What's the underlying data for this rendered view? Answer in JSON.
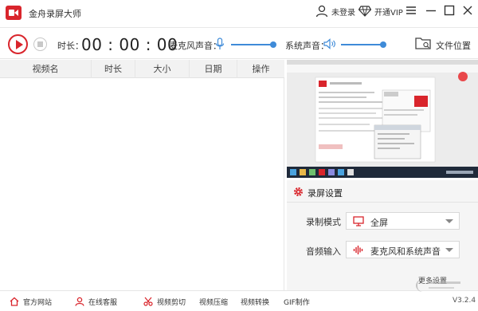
{
  "app": {
    "title": "金舟录屏大师"
  },
  "header": {
    "login_label": "未登录",
    "vip_label": "开通VIP"
  },
  "toolbar": {
    "duration_label": "时长：",
    "timer": "00 : 00 : 00",
    "mic_label": "麦克风声音：",
    "mic_volume": 0.78,
    "system_label": "系统声音：",
    "system_volume": 0.78,
    "folder_label": "文件位置"
  },
  "table": {
    "columns": [
      "视频名",
      "时长",
      "大小",
      "日期",
      "操作"
    ],
    "rows": []
  },
  "settings": {
    "title": "录屏设置",
    "mode_label": "录制模式",
    "mode_value": "全屏",
    "audio_label": "音频输入",
    "audio_value": "麦克风和系统声音",
    "more_label": "更多设置"
  },
  "footer": {
    "items": [
      "官方网站",
      "在线客服",
      "视频剪切",
      "视频压缩",
      "视频转换",
      "GIF制作"
    ],
    "version": "V3.2.4"
  },
  "colors": {
    "accent": "#d9252c",
    "slider": "#3f8bd8"
  }
}
